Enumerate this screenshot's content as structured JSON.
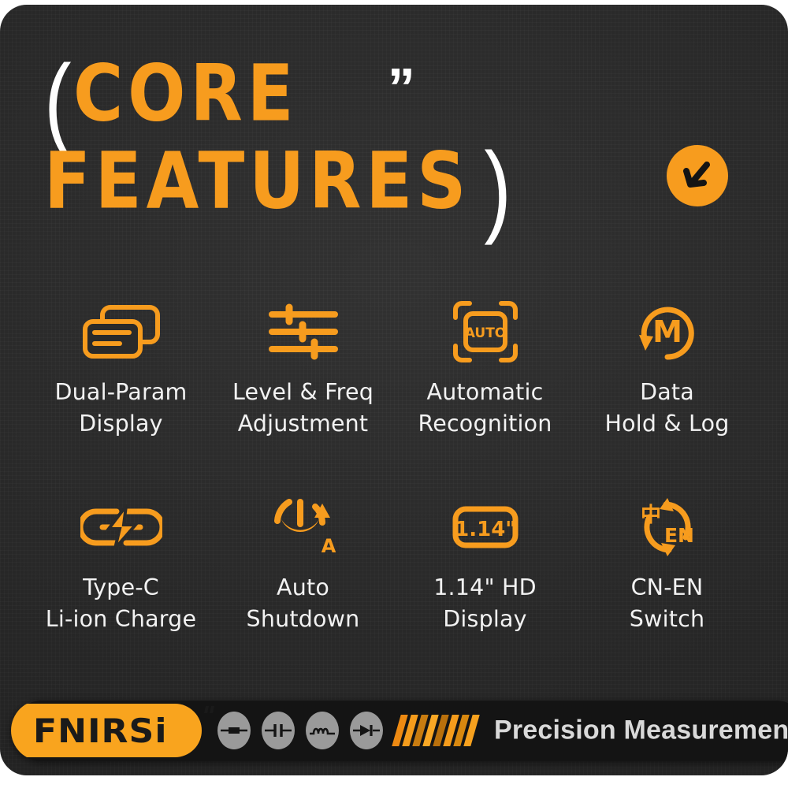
{
  "theme": {
    "accent": "#F79C1E",
    "accent_alt": "#F9A41E",
    "card_bg": "#2a2a2a",
    "footer_bg": "#141414",
    "text": "#f2f2f2",
    "paren": "#ffffff"
  },
  "header": {
    "paren_open": "(",
    "word1": "CORE",
    "quote": "”",
    "word2": "FEATURES",
    "paren_close": ")",
    "badge_icon": "down-left-arrow-icon"
  },
  "features": [
    {
      "icon": "dual-card-display-icon",
      "label_line1": "Dual-Param",
      "label_line2": "Display"
    },
    {
      "icon": "sliders-icon",
      "label_line1": "Level & Freq",
      "label_line2": "Adjustment"
    },
    {
      "icon": "auto-scan-icon",
      "icon_text": "AUTO",
      "label_line1": "Automatic",
      "label_line2": "Recognition"
    },
    {
      "icon": "memory-refresh-icon",
      "icon_text": "M",
      "label_line1": "Data",
      "label_line2": "Hold & Log"
    },
    {
      "icon": "usb-c-charge-icon",
      "label_line1": "Type-C",
      "label_line2": "Li-ion Charge"
    },
    {
      "icon": "auto-power-off-icon",
      "icon_text": "A",
      "label_line1": "Auto",
      "label_line2": "Shutdown"
    },
    {
      "icon": "screen-size-icon",
      "icon_text": "1.14\"",
      "label_line1": "1.14\" HD",
      "label_line2": "Display"
    },
    {
      "icon": "language-switch-icon",
      "icon_text_cn": "中",
      "icon_text_en": "EN",
      "label_line1": "CN-EN",
      "label_line2": "Switch"
    }
  ],
  "footer": {
    "brand": "FNIRSi",
    "tagline": "Precision Measurement",
    "component_icons": [
      "resistor-icon",
      "capacitor-icon",
      "inductor-icon",
      "diode-icon"
    ],
    "stripe_count": 8
  }
}
